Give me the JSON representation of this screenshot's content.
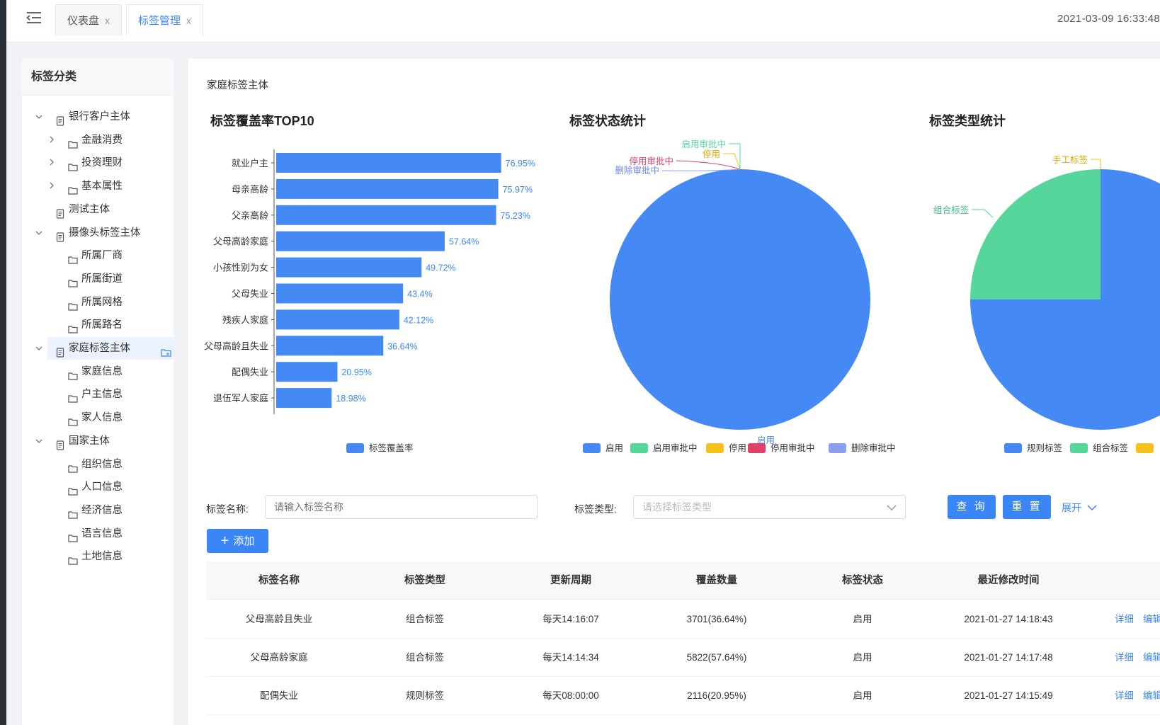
{
  "tabs": [
    {
      "label": "仪表盘",
      "close": "x"
    },
    {
      "label": "标签管理",
      "close": "x"
    }
  ],
  "datetime": "2021-03-09 16:33:48",
  "sidebar": {
    "title": "标签分类",
    "items": [
      {
        "label": "银行客户主体",
        "level": 0,
        "icon": "document-icon",
        "caret": "down"
      },
      {
        "label": "金融消费",
        "level": 1,
        "icon": "folder-icon",
        "caret": "right"
      },
      {
        "label": "投资理财",
        "level": 1,
        "icon": "folder-icon",
        "caret": "right"
      },
      {
        "label": "基本属性",
        "level": 1,
        "icon": "folder-icon",
        "caret": "right"
      },
      {
        "label": "测试主体",
        "level": 0,
        "icon": "document-icon",
        "caret": ""
      },
      {
        "label": "摄像头标签主体",
        "level": 0,
        "icon": "document-icon",
        "caret": "down"
      },
      {
        "label": "所属厂商",
        "level": 1,
        "icon": "folder-icon",
        "caret": ""
      },
      {
        "label": "所属街道",
        "level": 1,
        "icon": "folder-icon",
        "caret": ""
      },
      {
        "label": "所属网格",
        "level": 1,
        "icon": "folder-icon",
        "caret": ""
      },
      {
        "label": "所属路名",
        "level": 1,
        "icon": "folder-icon",
        "caret": ""
      },
      {
        "label": "家庭标签主体",
        "level": 0,
        "icon": "document-icon",
        "caret": "down",
        "selected": true
      },
      {
        "label": "家庭信息",
        "level": 1,
        "icon": "folder-icon",
        "caret": ""
      },
      {
        "label": "户主信息",
        "level": 1,
        "icon": "folder-icon",
        "caret": ""
      },
      {
        "label": "家人信息",
        "level": 1,
        "icon": "folder-icon",
        "caret": ""
      },
      {
        "label": "国家主体",
        "level": 0,
        "icon": "document-icon",
        "caret": "down"
      },
      {
        "label": "组织信息",
        "level": 1,
        "icon": "folder-icon",
        "caret": ""
      },
      {
        "label": "人口信息",
        "level": 1,
        "icon": "folder-icon",
        "caret": ""
      },
      {
        "label": "经济信息",
        "level": 1,
        "icon": "folder-icon",
        "caret": ""
      },
      {
        "label": "语言信息",
        "level": 1,
        "icon": "folder-icon",
        "caret": ""
      },
      {
        "label": "土地信息",
        "level": 1,
        "icon": "folder-icon",
        "caret": ""
      }
    ]
  },
  "breadcrumb": "家庭标签主体",
  "colors": {
    "accent": "#3b86f7",
    "bar": "#4489f4",
    "green": "#56d69b",
    "yellow": "#f5c21b",
    "red": "#e0416a",
    "purple": "#8a9ff0"
  },
  "chart_data": [
    {
      "type": "bar",
      "title": "标签覆盖率TOP10",
      "orientation": "horizontal",
      "categories": [
        "就业户主",
        "母亲高龄",
        "父亲高龄",
        "父母高龄家庭",
        "小孩性别为女",
        "父母失业",
        "残疾人家庭",
        "父母高龄且失业",
        "配偶失业",
        "退伍军人家庭"
      ],
      "values": [
        76.95,
        75.97,
        75.23,
        57.64,
        49.72,
        43.4,
        42.12,
        36.64,
        20.95,
        18.98
      ],
      "data_labels": [
        "76.95%",
        "75.97%",
        "75.23%",
        "57.64%",
        "49.72%",
        "43.4%",
        "42.12%",
        "36.64%",
        "20.95%",
        "18.98%"
      ],
      "series": [
        {
          "name": "标签覆盖率"
        }
      ],
      "xlim": [
        0,
        100
      ],
      "legend": "bottom"
    },
    {
      "type": "pie",
      "title": "标签状态统计",
      "slices": [
        {
          "name": "启用",
          "value": 100,
          "color": "#4489f4"
        },
        {
          "name": "启用审批中",
          "value": 0,
          "color": "#56d69b"
        },
        {
          "name": "停用",
          "value": 0,
          "color": "#f5c21b"
        },
        {
          "name": "停用审批中",
          "value": 0,
          "color": "#e0416a"
        },
        {
          "name": "删除审批中",
          "value": 0,
          "color": "#8a9ff0"
        }
      ],
      "legend": "bottom"
    },
    {
      "type": "pie",
      "title": "标签类型统计",
      "slices": [
        {
          "name": "规则标签",
          "value": 75,
          "color": "#4489f4"
        },
        {
          "name": "组合标签",
          "value": 25,
          "color": "#56d69b"
        },
        {
          "name": "手工标签",
          "value": 0,
          "color": "#f5c21b"
        }
      ],
      "legend": "bottom"
    }
  ],
  "filters": {
    "name_label": "标签名称:",
    "name_placeholder": "请输入标签名称",
    "type_label": "标签类型:",
    "type_placeholder": "请选择标签类型",
    "query": "查 询",
    "reset": "重 置",
    "expand": "展开"
  },
  "add_button": "添加",
  "table": {
    "headers": [
      "标签名称",
      "标签类型",
      "更新周期",
      "覆盖数量",
      "标签状态",
      "最近修改时间"
    ],
    "rows": [
      {
        "name": "父母高龄且失业",
        "type": "组合标签",
        "cycle": "每天14:16:07",
        "coverage": "3701(36.64%)",
        "status": "启用",
        "modified": "2021-01-27 14:18:43",
        "detail": "详细",
        "edit": "编辑"
      },
      {
        "name": "父母高龄家庭",
        "type": "组合标签",
        "cycle": "每天14:14:34",
        "coverage": "5822(57.64%)",
        "status": "启用",
        "modified": "2021-01-27 14:17:48",
        "detail": "详细",
        "edit": "编辑"
      },
      {
        "name": "配偶失业",
        "type": "规则标签",
        "cycle": "每天08:00:00",
        "coverage": "2116(20.95%)",
        "status": "启用",
        "modified": "2021-01-27 14:15:49",
        "detail": "详细",
        "edit": "编辑"
      }
    ]
  }
}
